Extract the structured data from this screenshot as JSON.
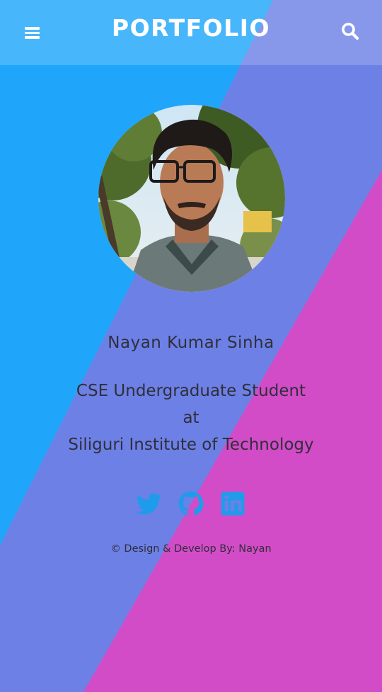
{
  "colors": {
    "blue": "#1fa6fb",
    "violet": "#6d80e6",
    "magenta": "#d34cc7",
    "text": "#2f2f3a",
    "social_icon": "#1f9bec"
  },
  "navbar": {
    "menu_icon": "hamburger-menu-icon",
    "brand": "PORTFOLIO",
    "search_icon": "search-icon"
  },
  "profile": {
    "name": "Nayan Kumar Sinha",
    "role_line1": "CSE Undergraduate Student",
    "role_line2": "at",
    "role_line3": "Siliguri Institute of Technology"
  },
  "social": {
    "icons": [
      "twitter-icon",
      "github-icon",
      "linkedin-icon"
    ]
  },
  "footer": {
    "text": "© Design & Develop By: Nayan"
  }
}
